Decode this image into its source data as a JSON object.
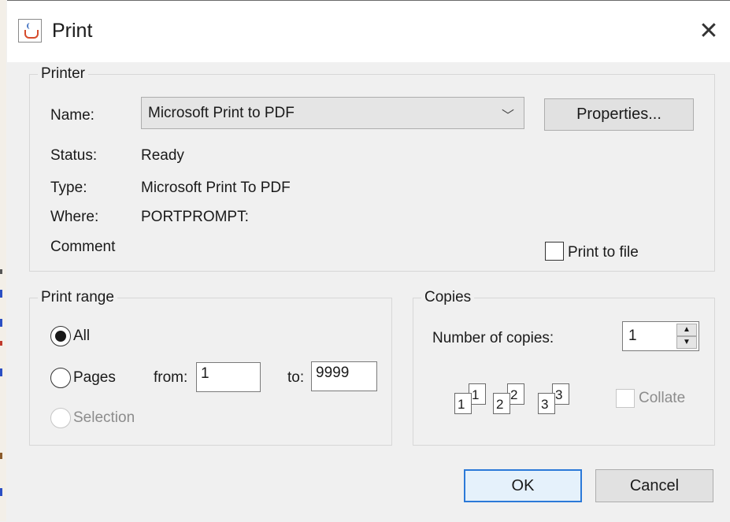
{
  "window": {
    "title": "Print"
  },
  "printer": {
    "legend": "Printer",
    "name_label": "Name:",
    "name_value": "Microsoft Print to PDF",
    "properties_label": "Properties...",
    "status_label": "Status:",
    "status_value": "Ready",
    "type_label": "Type:",
    "type_value": "Microsoft Print To PDF",
    "where_label": "Where:",
    "where_value": "PORTPROMPT:",
    "comment_label": "Comment",
    "print_to_file_label": "Print to file",
    "print_to_file_checked": false
  },
  "print_range": {
    "legend": "Print range",
    "all_label": "All",
    "pages_label": "Pages",
    "from_label": "from:",
    "from_value": "1",
    "to_label": "to:",
    "to_value": "9999",
    "selection_label": "Selection",
    "selected": "all"
  },
  "copies": {
    "legend": "Copies",
    "number_label": "Number of copies:",
    "number_value": "1",
    "collate_label": "Collate",
    "collate_checked": false,
    "illustration": [
      {
        "back": "1",
        "front": "1"
      },
      {
        "back": "2",
        "front": "2"
      },
      {
        "back": "3",
        "front": "3"
      }
    ]
  },
  "buttons": {
    "ok_label": "OK",
    "cancel_label": "Cancel"
  },
  "colors": {
    "accent": "#2b79d8",
    "dialog_bg": "#f0f0f0",
    "titlebar_bg": "#ffffff"
  }
}
